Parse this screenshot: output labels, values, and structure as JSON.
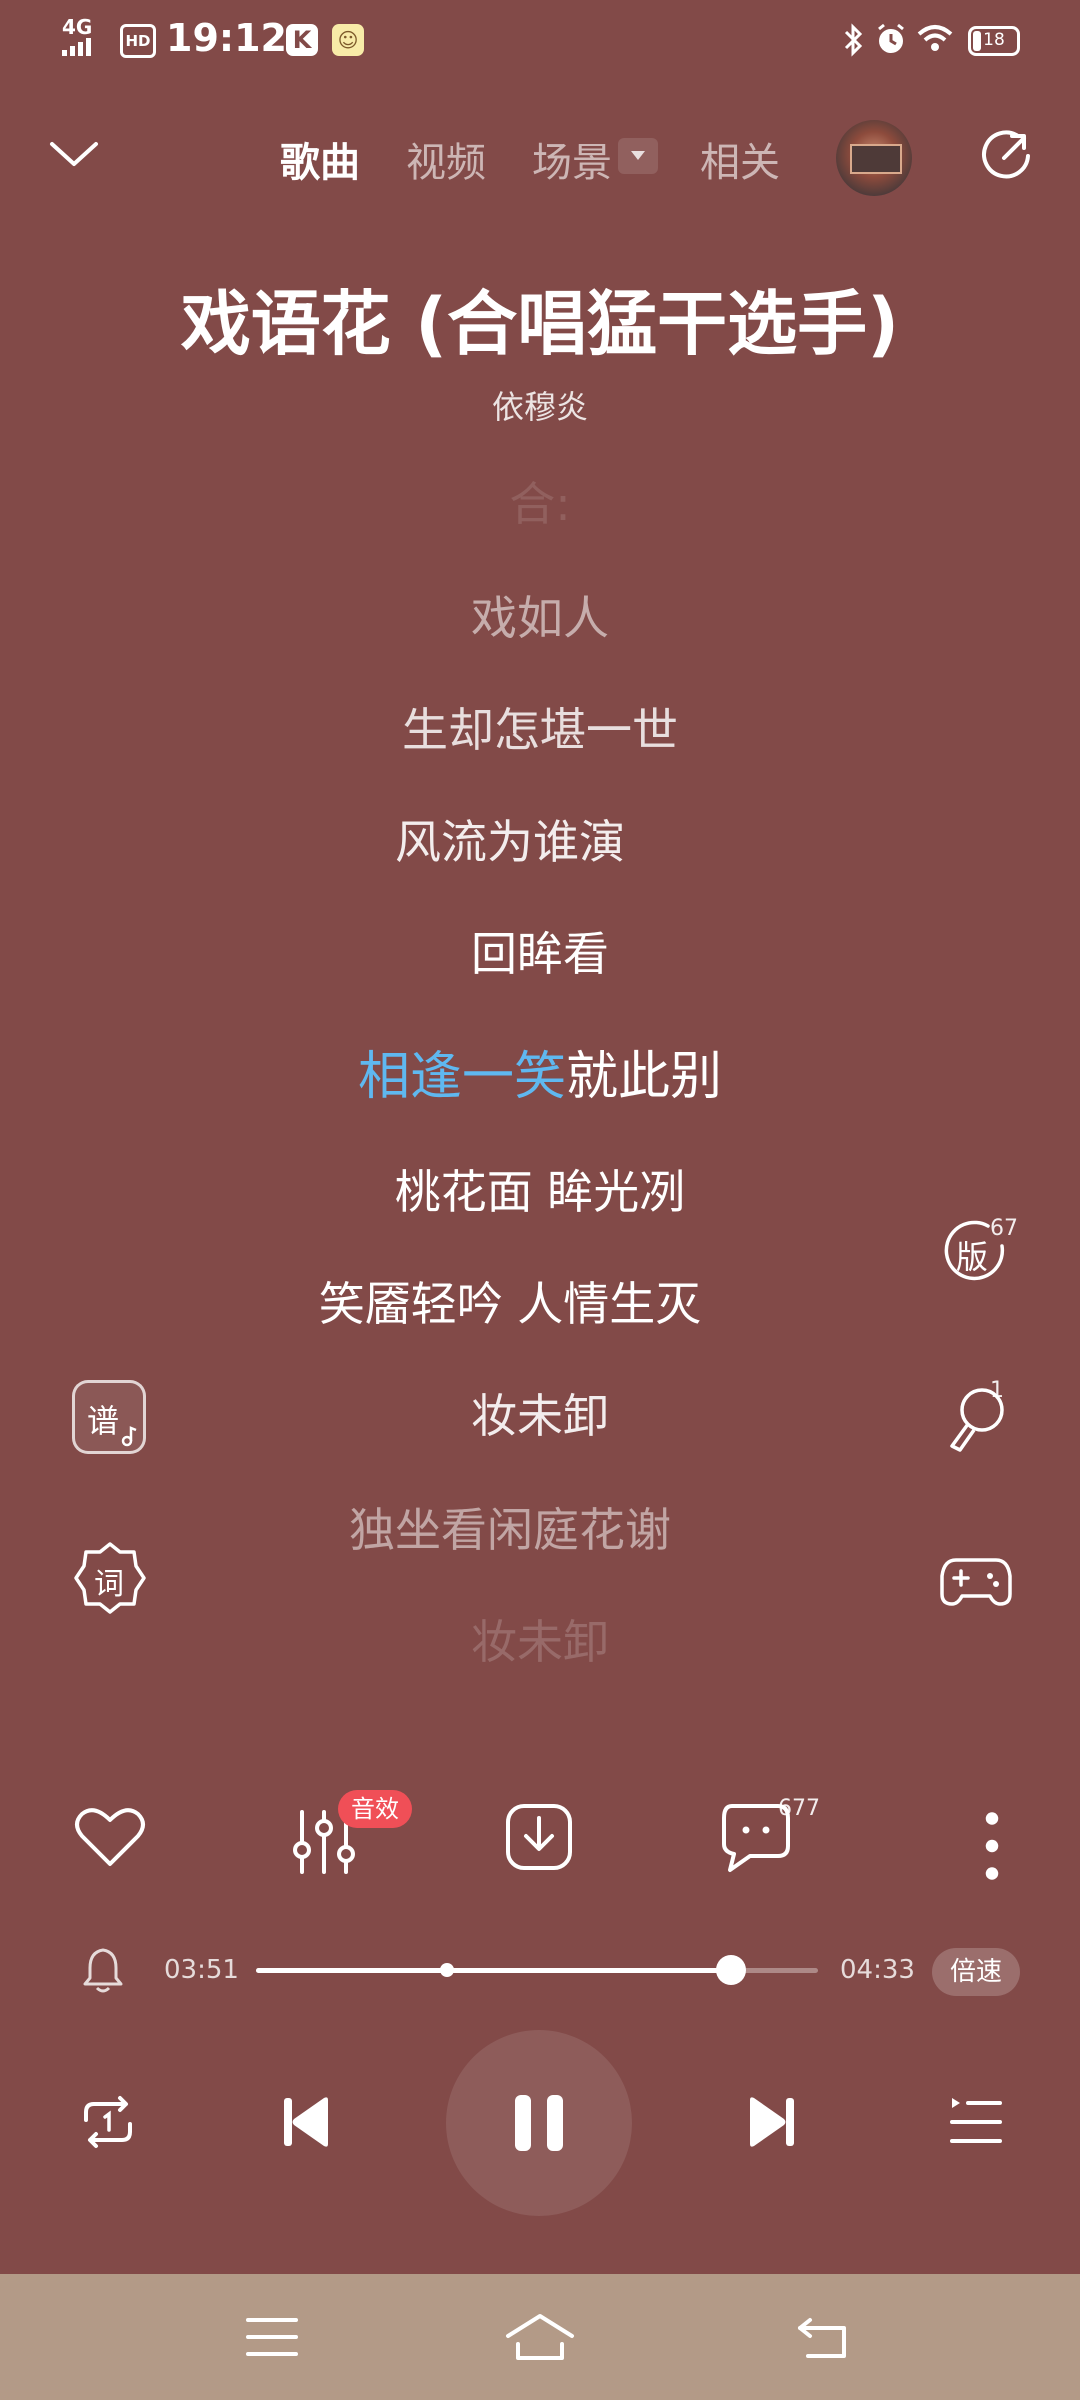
{
  "status_bar": {
    "network": "4G",
    "hd": "HD",
    "time": "19:12",
    "battery": "18",
    "icons": [
      "bluetooth-icon",
      "alarm-icon",
      "wifi-icon",
      "battery-icon"
    ]
  },
  "nav": {
    "tabs": [
      {
        "label": "歌曲",
        "active": true
      },
      {
        "label": "视频",
        "active": false
      },
      {
        "label": "场景",
        "active": false
      },
      {
        "label": "相关",
        "active": false
      }
    ]
  },
  "song": {
    "title": "戏语花 (合唱猛干选手)",
    "artist": "依穆炎"
  },
  "lyrics": [
    {
      "text": "合:"
    },
    {
      "text": "戏如人"
    },
    {
      "text": "生却怎堪一世"
    },
    {
      "text": "风流为谁演"
    },
    {
      "text": "回眸看"
    },
    {
      "text": "相逢一笑就此别",
      "highlighted": "相逢一笑",
      "rest": "就此别"
    },
    {
      "text": "桃花面 眸光冽"
    },
    {
      "text": "笑靥轻吟 人情生灭"
    },
    {
      "text": "妆未卸"
    },
    {
      "text": "独坐看闲庭花谢"
    },
    {
      "text": "妆未卸"
    }
  ],
  "side_icons": {
    "left": [
      {
        "name": "sheet-music-icon",
        "label": "谱"
      },
      {
        "name": "lyrics-icon",
        "label": "词"
      }
    ],
    "right": [
      {
        "name": "version-icon",
        "label": "版",
        "count": "67"
      },
      {
        "name": "sing-mic-icon",
        "count": "1"
      },
      {
        "name": "game-controller-icon"
      }
    ]
  },
  "actions": {
    "sfx_badge": "音效",
    "comment_count": "677"
  },
  "progress": {
    "current": "03:51",
    "total": "04:33",
    "fraction": 0.846,
    "buffer_marker_fraction": 0.34,
    "speed_label": "倍速"
  },
  "colors": {
    "background": "#824A48",
    "lyric_highlight": "#5FB8F0",
    "sfx_badge": "#F04F57",
    "nav_bar": "#B39A87"
  }
}
